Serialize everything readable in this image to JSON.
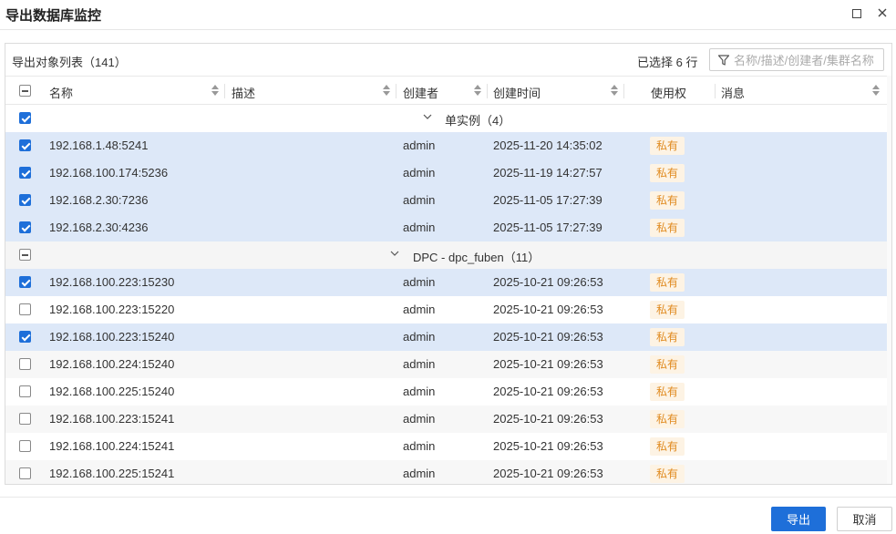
{
  "dialog": {
    "title": "导出数据库监控"
  },
  "panel": {
    "list_title": "导出对象列表（141）",
    "selected_text": "已选择 6 行",
    "filter_placeholder": "名称/描述/创建者/集群名称"
  },
  "columns": {
    "name": "名称",
    "desc": "描述",
    "creator": "创建者",
    "created_time": "创建时间",
    "permission": "使用权",
    "message": "消息"
  },
  "groups": [
    {
      "label": "单实例（4）",
      "checked": "all",
      "rows": [
        {
          "name": "192.168.1.48:5241",
          "creator": "admin",
          "time": "2025-11-20 14:35:02",
          "permission": "私有",
          "checked": true
        },
        {
          "name": "192.168.100.174:5236",
          "creator": "admin",
          "time": "2025-11-19 14:27:57",
          "permission": "私有",
          "checked": true
        },
        {
          "name": "192.168.2.30:7236",
          "creator": "admin",
          "time": "2025-11-05 17:27:39",
          "permission": "私有",
          "checked": true
        },
        {
          "name": "192.168.2.30:4236",
          "creator": "admin",
          "time": "2025-11-05 17:27:39",
          "permission": "私有",
          "checked": true
        }
      ]
    },
    {
      "label": "DPC - dpc_fuben（11）",
      "checked": "partial",
      "rows": [
        {
          "name": "192.168.100.223:15230",
          "creator": "admin",
          "time": "2025-10-21 09:26:53",
          "permission": "私有",
          "checked": true
        },
        {
          "name": "192.168.100.223:15220",
          "creator": "admin",
          "time": "2025-10-21 09:26:53",
          "permission": "私有",
          "checked": false
        },
        {
          "name": "192.168.100.223:15240",
          "creator": "admin",
          "time": "2025-10-21 09:26:53",
          "permission": "私有",
          "checked": true
        },
        {
          "name": "192.168.100.224:15240",
          "creator": "admin",
          "time": "2025-10-21 09:26:53",
          "permission": "私有",
          "checked": false
        },
        {
          "name": "192.168.100.225:15240",
          "creator": "admin",
          "time": "2025-10-21 09:26:53",
          "permission": "私有",
          "checked": false
        },
        {
          "name": "192.168.100.223:15241",
          "creator": "admin",
          "time": "2025-10-21 09:26:53",
          "permission": "私有",
          "checked": false
        },
        {
          "name": "192.168.100.224:15241",
          "creator": "admin",
          "time": "2025-10-21 09:26:53",
          "permission": "私有",
          "checked": false
        },
        {
          "name": "192.168.100.225:15241",
          "creator": "admin",
          "time": "2025-10-21 09:26:53",
          "permission": "私有",
          "checked": false
        }
      ]
    }
  ],
  "footer": {
    "export_label": "导出",
    "cancel_label": "取消"
  },
  "colors": {
    "accent": "#1e6fd9",
    "selected_row": "#dde8f8",
    "badge_bg": "#fdf3e4",
    "badge_text": "#e08a1e"
  }
}
